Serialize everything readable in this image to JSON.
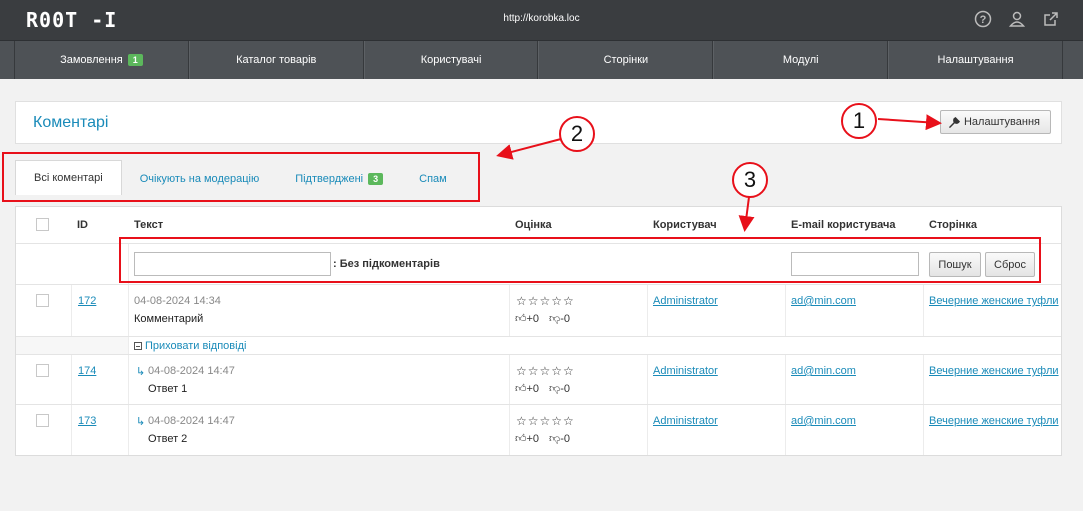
{
  "topbar": {
    "logo": "R00T -I",
    "url": "http://korobka.loc",
    "icons": [
      "help-icon",
      "user-icon",
      "external-link-icon"
    ]
  },
  "nav": {
    "items": [
      {
        "label": "Замовлення",
        "badge": "1"
      },
      {
        "label": "Каталог товарів"
      },
      {
        "label": "Користувачі"
      },
      {
        "label": "Сторінки"
      },
      {
        "label": "Модулі"
      },
      {
        "label": "Налаштування"
      }
    ]
  },
  "page": {
    "title": "Коментарі",
    "settings_button": "Налаштування"
  },
  "tabs": [
    {
      "label": "Всі коментарі",
      "active": true
    },
    {
      "label": "Очікують на модерацію"
    },
    {
      "label": "Підтверджені",
      "badge": "3"
    },
    {
      "label": "Спам"
    }
  ],
  "table": {
    "columns": {
      "id": "ID",
      "text": "Текст",
      "rating": "Оцінка",
      "user": "Користувач",
      "email": "E-mail користувача",
      "page": "Сторінка"
    },
    "filter": {
      "no_subcomments_label": ": Без підкоментарів",
      "search_button": "Пошук",
      "reset_button": "Сброс",
      "text_value": "",
      "email_value": ""
    },
    "toggle_label": "Приховати відповіді",
    "rows": [
      {
        "id": "172",
        "date": "04-08-2024 14:34",
        "text": "Комментарий",
        "stars": "☆☆☆☆☆",
        "up": "+0",
        "down": "-0",
        "user": "Administrator",
        "email": "ad@min.com",
        "page": "Вечерние женские туфли"
      },
      {
        "id": "174",
        "date": "04-08-2024 14:47",
        "text": "Ответ 1",
        "stars": "☆☆☆☆☆",
        "up": "+0",
        "down": "-0",
        "user": "Administrator",
        "email": "ad@min.com",
        "page": "Вечерние женские туфли"
      },
      {
        "id": "173",
        "date": "04-08-2024 14:47",
        "text": "Ответ 2",
        "stars": "☆☆☆☆☆",
        "up": "+0",
        "down": "-0",
        "user": "Administrator",
        "email": "ad@min.com",
        "page": "Вечерние женские туфли"
      }
    ]
  },
  "annotations": {
    "one": "1",
    "two": "2",
    "three": "3"
  },
  "colors": {
    "accent": "#1a8bb9",
    "badge": "#5cb85c",
    "annotation": "#e8101a",
    "topbar": "#3a3d40",
    "nav": "#4e5256"
  }
}
